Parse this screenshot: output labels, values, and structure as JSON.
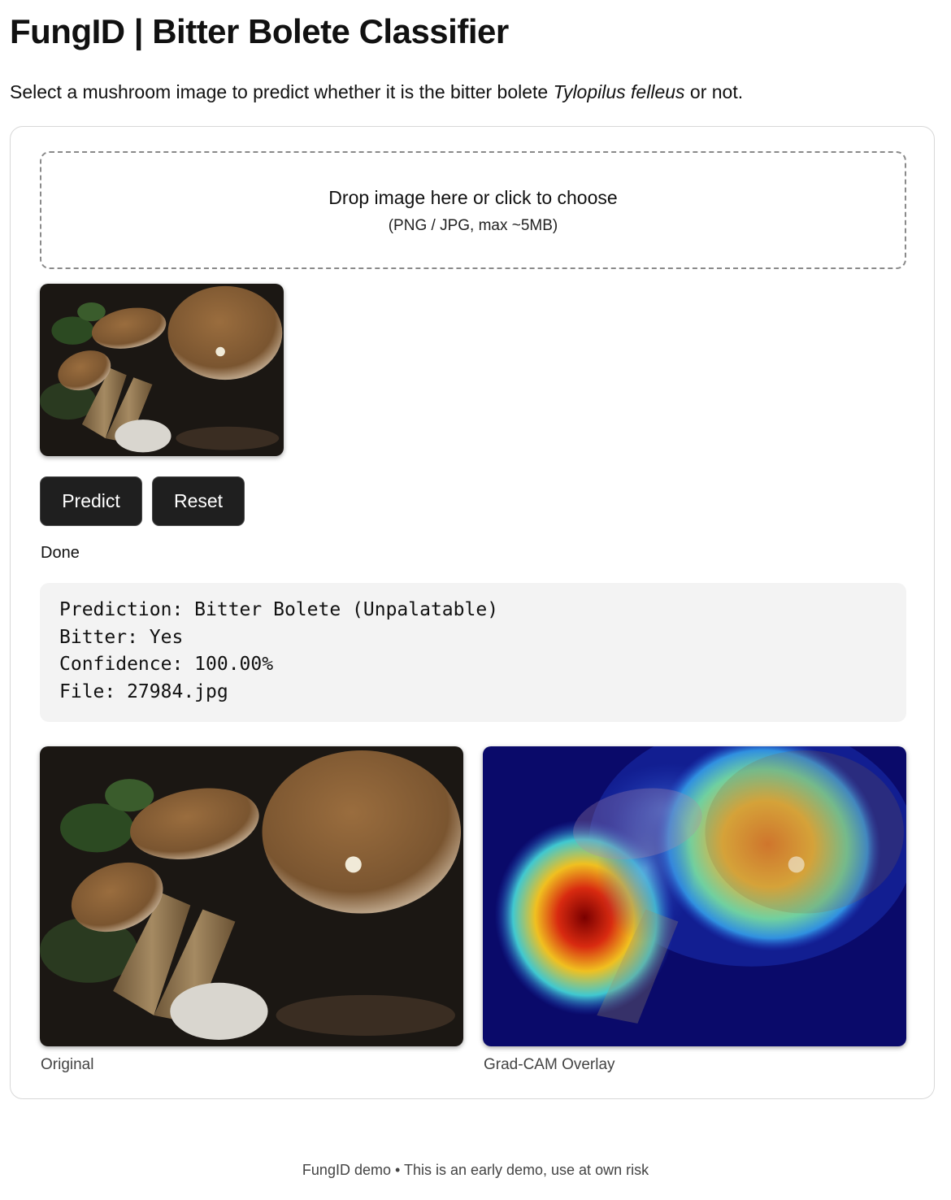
{
  "header": {
    "title": "FungID | Bitter Bolete Classifier",
    "intro_before": "Select a mushroom image to predict whether it is the bitter bolete ",
    "intro_species": "Tylopilus felleus",
    "intro_after": " or not."
  },
  "dropzone": {
    "main_text": "Drop image here or click to choose",
    "sub_text": "(PNG / JPG, max ~5MB)"
  },
  "actions": {
    "predict_label": "Predict",
    "reset_label": "Reset"
  },
  "status": "Done",
  "result": {
    "prediction_line": "Prediction: Bitter Bolete (Unpalatable)",
    "bitter_line": "Bitter: Yes",
    "confidence_line": "Confidence: 100.00%",
    "file_line": "File: 27984.jpg"
  },
  "images": {
    "original_caption": "Original",
    "gradcam_caption": "Grad-CAM Overlay"
  },
  "footer": {
    "text": "FungID demo • This is an early demo, use at own risk"
  },
  "colors": {
    "button_bg": "#1f1f1f",
    "result_bg": "#f3f3f3",
    "cap_brown": "#8a6238",
    "forest_floor": "#1b1713",
    "heatmap_base": "#0a0a6a"
  }
}
